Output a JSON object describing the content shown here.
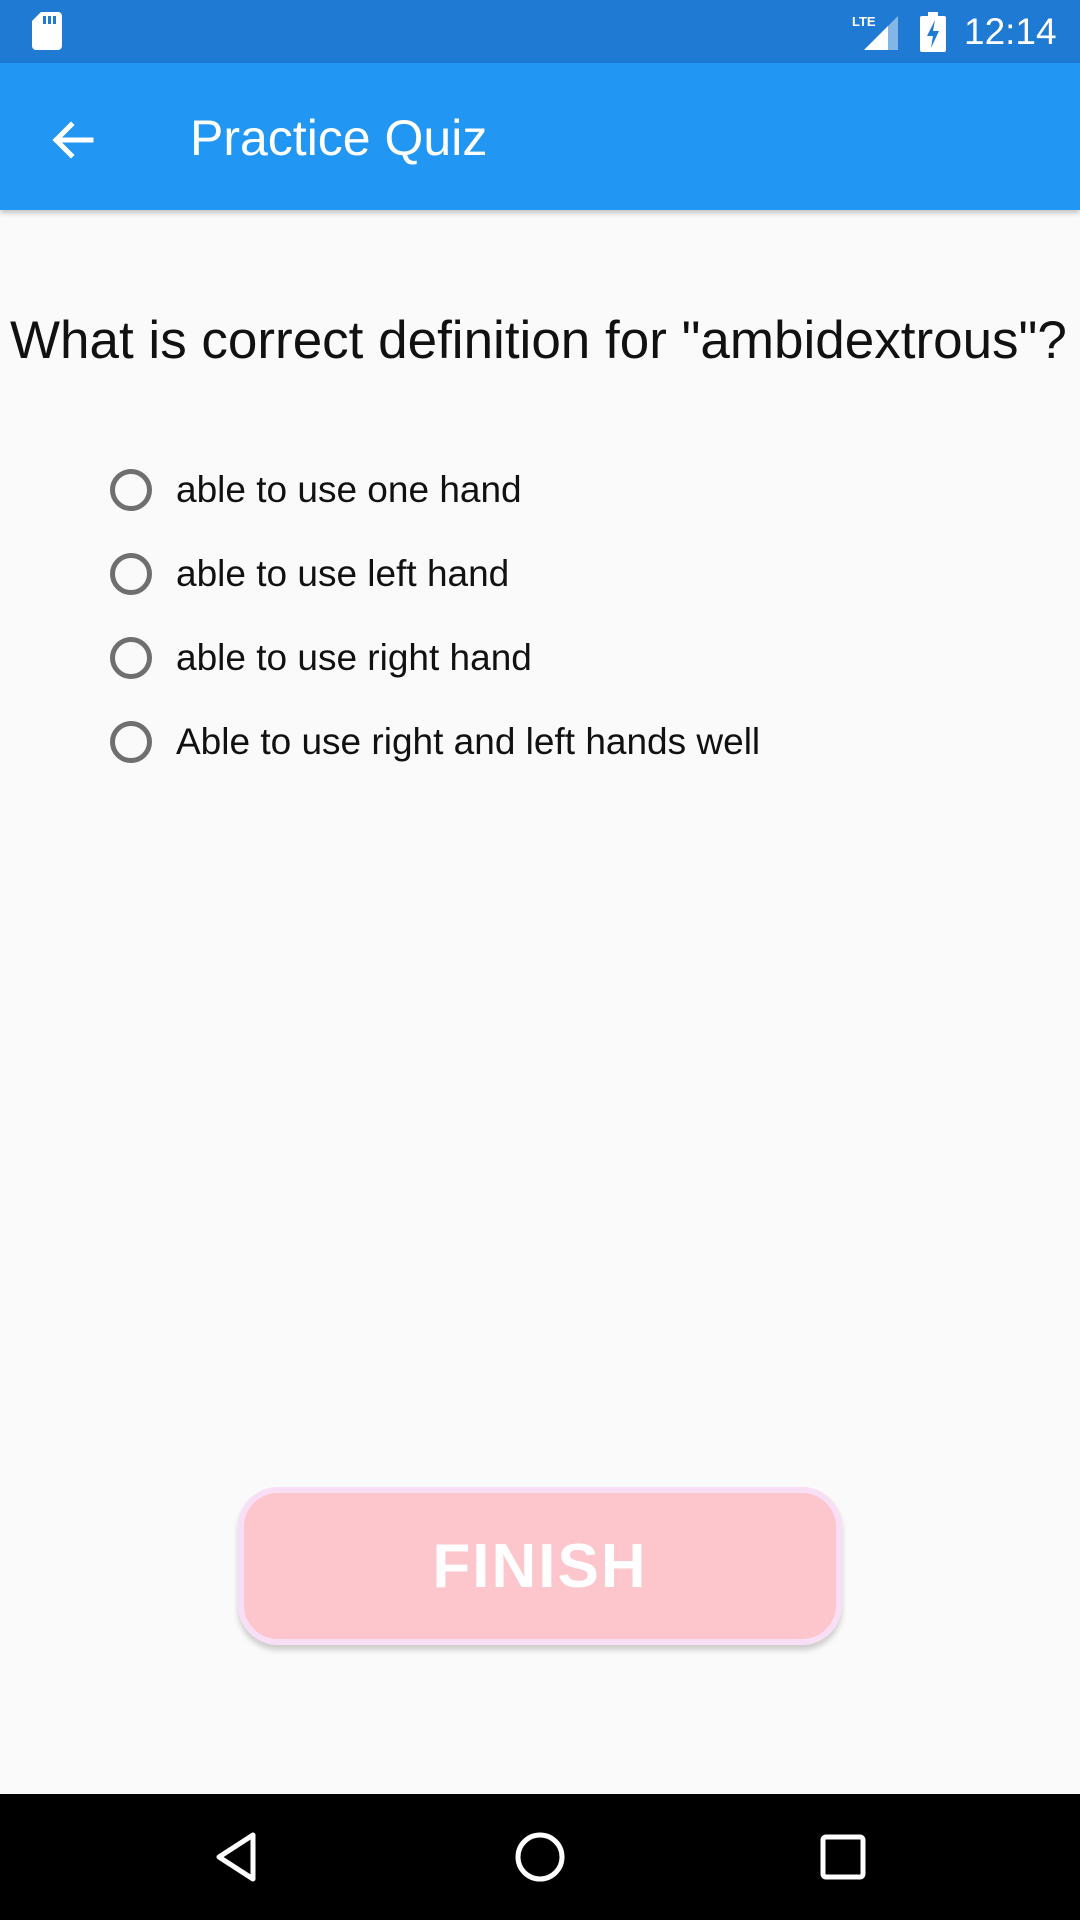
{
  "status_bar": {
    "time": "12:14",
    "icons": [
      "sd-card-icon",
      "lte-signal-icon",
      "battery-charging-icon"
    ]
  },
  "app_bar": {
    "title": "Practice Quiz",
    "back_icon": "arrow-back-icon"
  },
  "quiz": {
    "question": "What is correct definition for \"ambidextrous\"?",
    "options": [
      {
        "label": "able to use one hand",
        "selected": false
      },
      {
        "label": "able to use left hand",
        "selected": false
      },
      {
        "label": "able to use right hand",
        "selected": false
      },
      {
        "label": "Able to use right and left hands well",
        "selected": false
      }
    ],
    "finish_label": "FINISH"
  },
  "nav_bar": {
    "icons": [
      "back-triangle-icon",
      "home-circle-icon",
      "recents-square-icon"
    ]
  },
  "colors": {
    "status_bar": "#1e7ad3",
    "app_bar": "#2196f3",
    "finish_button": "#fdc5cc",
    "background": "#fafafa"
  }
}
